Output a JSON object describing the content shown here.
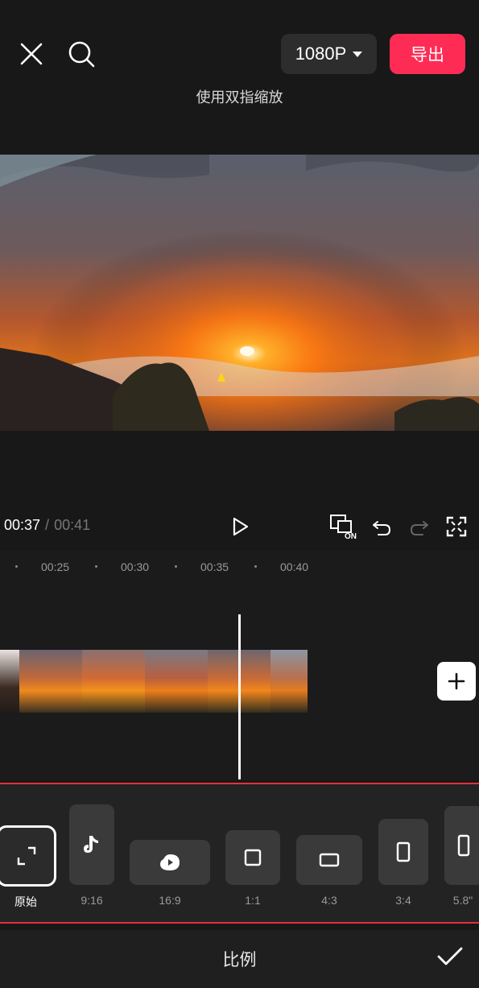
{
  "header": {
    "close_icon": "close-icon",
    "search_icon": "search-icon",
    "resolution_label": "1080P",
    "export_label": "导出",
    "export_color": "#fe2c55"
  },
  "hint": "使用双指缩放",
  "playback": {
    "current_time": "00:37",
    "separator": "/",
    "total_time": "00:41"
  },
  "ruler": {
    "labels": [
      "00:25",
      "00:30",
      "00:35",
      "00:40"
    ]
  },
  "ratio_options": [
    {
      "label": "原始",
      "icon": "crop-original-icon",
      "selected": true
    },
    {
      "label": "9:16",
      "icon": "tiktok-icon"
    },
    {
      "label": "16:9",
      "icon": "youtube-icon"
    },
    {
      "label": "1:1",
      "icon": "square-icon"
    },
    {
      "label": "4:3",
      "icon": "rect-landscape-icon"
    },
    {
      "label": "3:4",
      "icon": "rect-portrait-icon"
    },
    {
      "label": "5.8\"",
      "icon": "phone-portrait-icon"
    }
  ],
  "bottom": {
    "title": "比例",
    "confirm_icon": "checkmark-icon"
  },
  "keyframe_badge": "ON"
}
